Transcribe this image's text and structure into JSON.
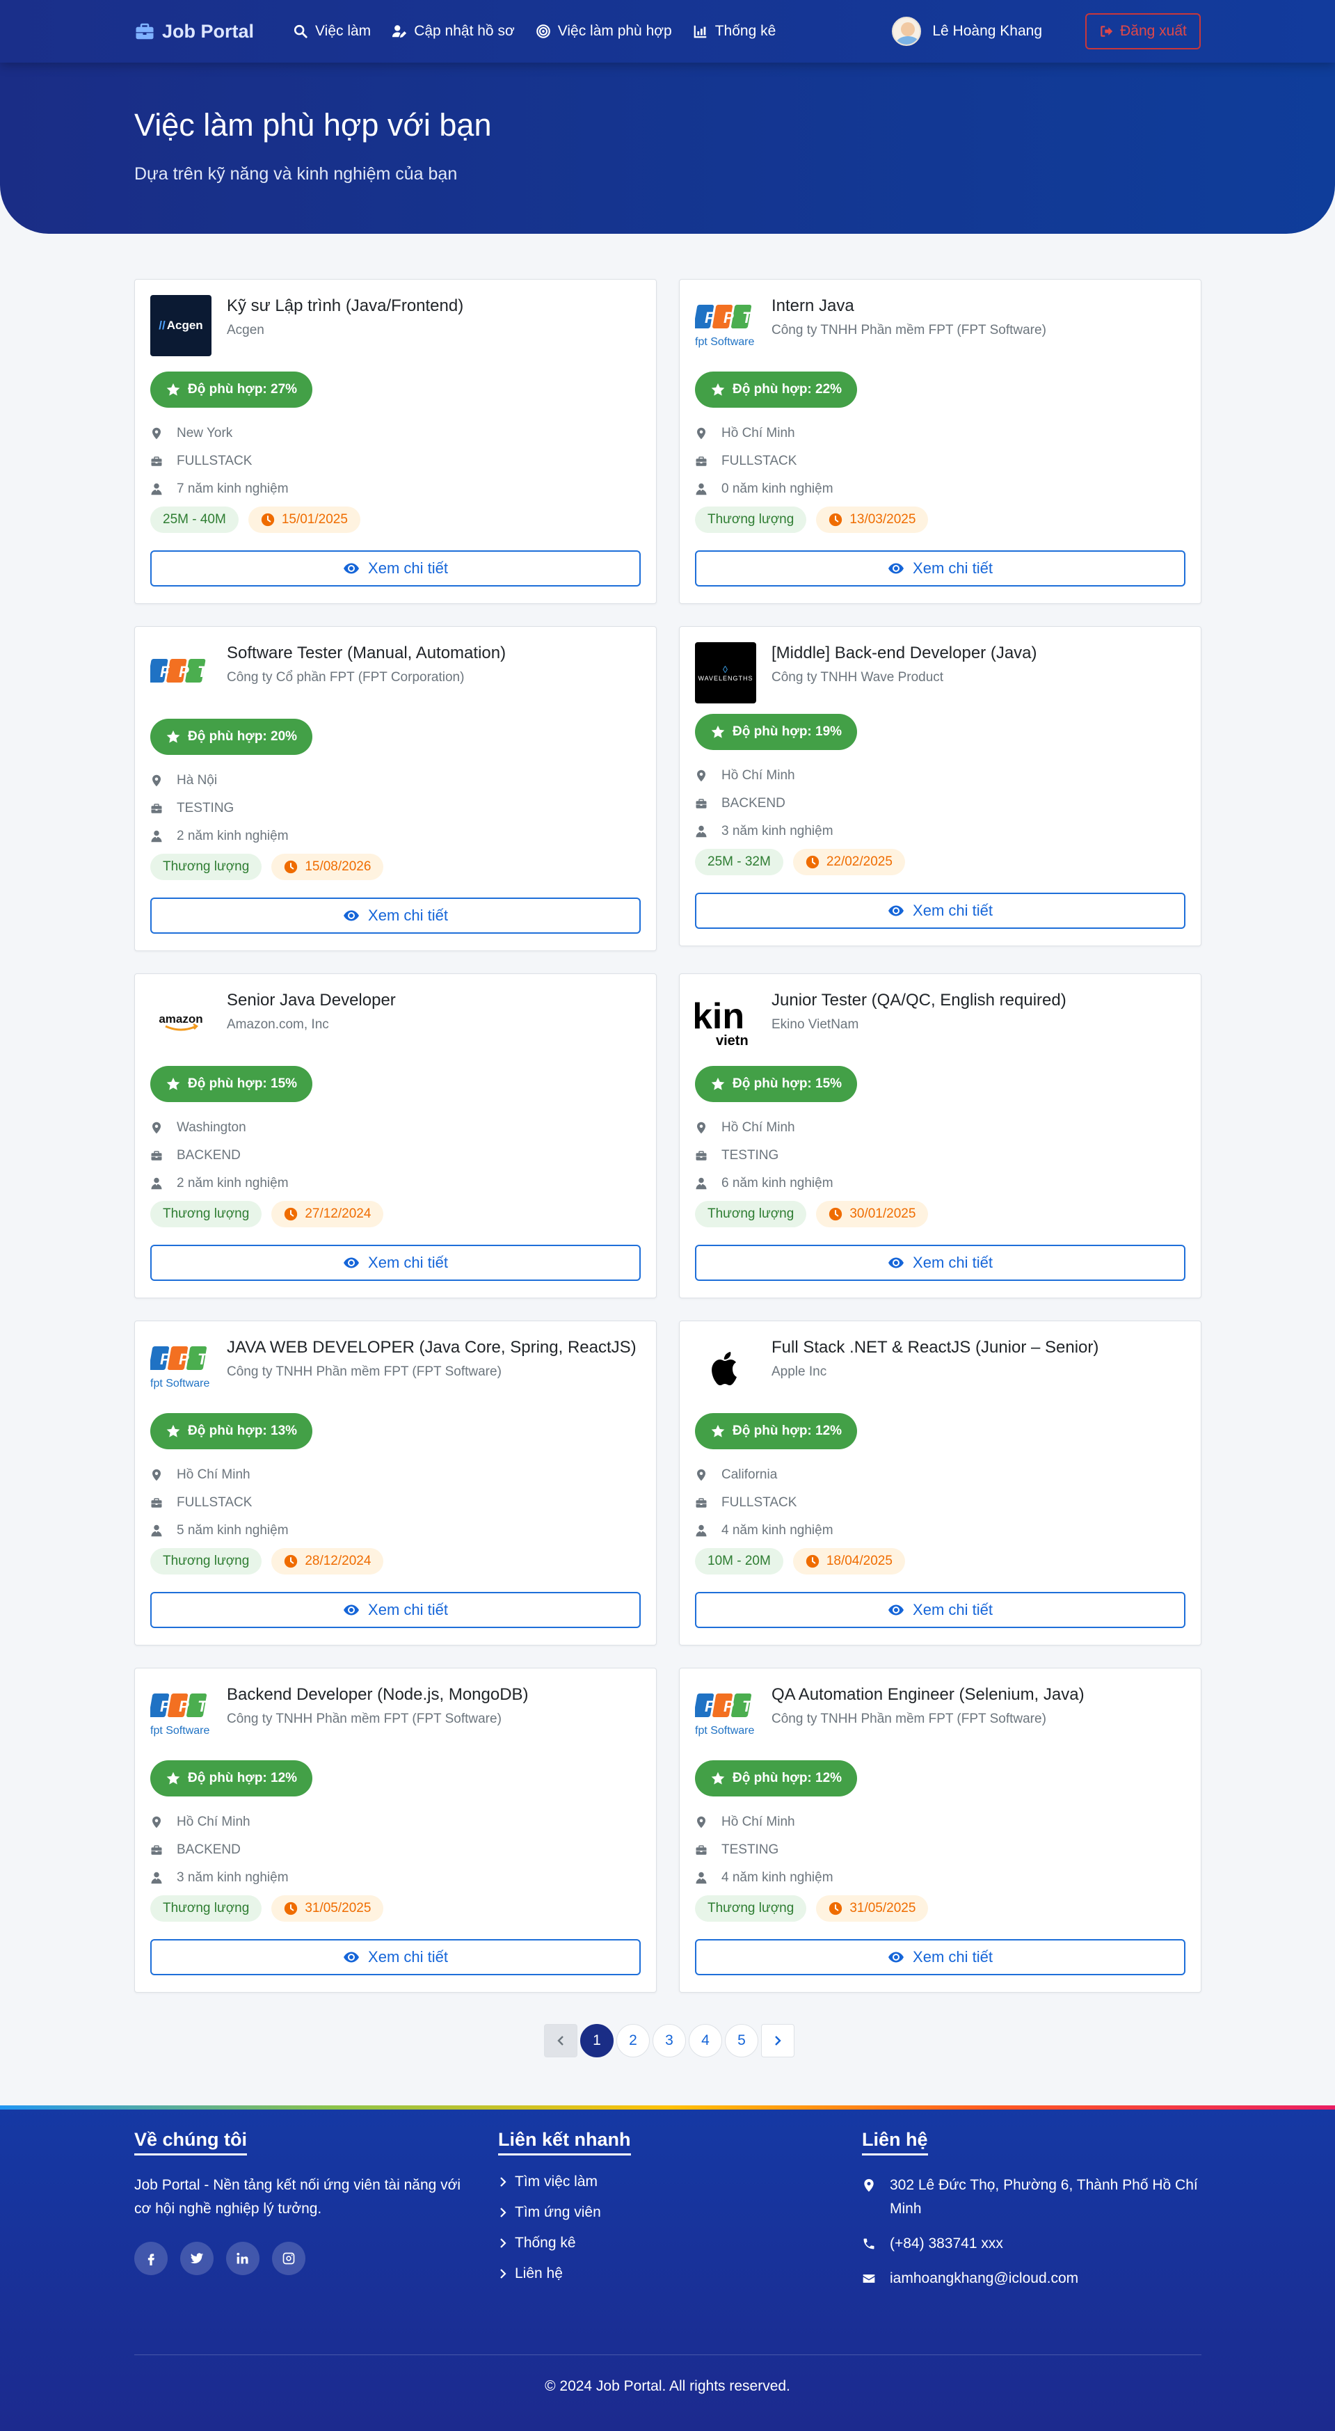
{
  "navbar": {
    "brand": "Job Portal",
    "menu": [
      {
        "label": "Việc làm",
        "icon": "search-icon"
      },
      {
        "label": "Cập nhật hồ sơ",
        "icon": "user-edit-icon"
      },
      {
        "label": "Việc làm phù hợp",
        "icon": "target-icon"
      },
      {
        "label": "Thống kê",
        "icon": "chart-icon"
      }
    ],
    "user_name": "Lê Hoàng Khang",
    "logout_label": "Đăng xuất"
  },
  "hero": {
    "title": "Việc làm phù hợp với bạn",
    "subtitle": "Dựa trên kỹ năng và kinh nghiệm của bạn"
  },
  "jobs": [
    {
      "title": "Kỹ sư Lập trình (Java/Frontend)",
      "company": "Acgen",
      "logo": "acgen",
      "match": "Độ phù hợp: 27%",
      "location": "New York",
      "category": "FULLSTACK",
      "experience": "7 năm kinh nghiệm",
      "salary": "25M - 40M",
      "deadline": "15/01/2025",
      "detail_label": "Xem chi tiết"
    },
    {
      "title": "Intern Java",
      "company": "Công ty TNHH Phần mềm FPT (FPT Software)",
      "logo": "fpt-software",
      "match": "Độ phù hợp: 22%",
      "location": "Hồ Chí Minh",
      "category": "FULLSTACK",
      "experience": "0 năm kinh nghiệm",
      "salary": "Thương lượng",
      "deadline": "13/03/2025",
      "detail_label": "Xem chi tiết"
    },
    {
      "title": "Software Tester (Manual, Automation)",
      "company": "Công ty Cổ phần FPT (FPT Corporation)",
      "logo": "fpt",
      "match": "Độ phù hợp: 20%",
      "location": "Hà Nội",
      "category": "TESTING",
      "experience": "2 năm kinh nghiệm",
      "salary": "Thương lượng",
      "deadline": "15/08/2026",
      "detail_label": "Xem chi tiết"
    },
    {
      "title": "[Middle] Back-end Developer (Java)",
      "company": "Công ty TNHH Wave Product",
      "logo": "wavelengths",
      "match": "Độ phù hợp: 19%",
      "location": "Hồ Chí Minh",
      "category": "BACKEND",
      "experience": "3 năm kinh nghiệm",
      "salary": "25M - 32M",
      "deadline": "22/02/2025",
      "detail_label": "Xem chi tiết"
    },
    {
      "title": "Senior Java Developer",
      "company": "Amazon.com, Inc",
      "logo": "amazon",
      "match": "Độ phù hợp: 15%",
      "location": "Washington",
      "category": "BACKEND",
      "experience": "2 năm kinh nghiệm",
      "salary": "Thương lượng",
      "deadline": "27/12/2024",
      "detail_label": "Xem chi tiết"
    },
    {
      "title": "Junior Tester (QA/QC, English required)",
      "company": "Ekino VietNam",
      "logo": "ekino",
      "match": "Độ phù hợp: 15%",
      "location": "Hồ Chí Minh",
      "category": "TESTING",
      "experience": "6 năm kinh nghiệm",
      "salary": "Thương lượng",
      "deadline": "30/01/2025",
      "detail_label": "Xem chi tiết"
    },
    {
      "title": "JAVA WEB DEVELOPER (Java Core, Spring, ReactJS)",
      "company": "Công ty TNHH Phần mềm FPT (FPT Software)",
      "logo": "fpt-software",
      "match": "Độ phù hợp: 13%",
      "location": "Hồ Chí Minh",
      "category": "FULLSTACK",
      "experience": "5 năm kinh nghiệm",
      "salary": "Thương lượng",
      "deadline": "28/12/2024",
      "detail_label": "Xem chi tiết"
    },
    {
      "title": "Full Stack .NET & ReactJS (Junior – Senior)",
      "company": "Apple Inc",
      "logo": "apple",
      "match": "Độ phù hợp: 12%",
      "location": "California",
      "category": "FULLSTACK",
      "experience": "4 năm kinh nghiệm",
      "salary": "10M - 20M",
      "deadline": "18/04/2025",
      "detail_label": "Xem chi tiết"
    },
    {
      "title": "Backend Developer (Node.js, MongoDB)",
      "company": "Công ty TNHH Phần mềm FPT (FPT Software)",
      "logo": "fpt-software",
      "match": "Độ phù hợp: 12%",
      "location": "Hồ Chí Minh",
      "category": "BACKEND",
      "experience": "3 năm kinh nghiệm",
      "salary": "Thương lượng",
      "deadline": "31/05/2025",
      "detail_label": "Xem chi tiết"
    },
    {
      "title": "QA Automation Engineer (Selenium, Java)",
      "company": "Công ty TNHH Phần mềm FPT (FPT Software)",
      "logo": "fpt-software",
      "match": "Độ phù hợp: 12%",
      "location": "Hồ Chí Minh",
      "category": "TESTING",
      "experience": "4 năm kinh nghiệm",
      "salary": "Thương lượng",
      "deadline": "31/05/2025",
      "detail_label": "Xem chi tiết"
    }
  ],
  "pagination": {
    "pages": [
      "1",
      "2",
      "3",
      "4",
      "5"
    ],
    "current": "1"
  },
  "footer": {
    "about_title": "Về chúng tôi",
    "about_text": "Job Portal - Nền tảng kết nối ứng viên tài năng với cơ hội nghề nghiệp lý tưởng.",
    "socials": [
      "facebook-icon",
      "twitter-icon",
      "linkedin-icon",
      "instagram-icon"
    ],
    "links_title": "Liên kết nhanh",
    "links": [
      "Tìm việc làm",
      "Tìm ứng viên",
      "Thống kê",
      "Liên hệ"
    ],
    "contact_title": "Liên hệ",
    "address": "302 Lê Đức Thọ, Phường 6, Thành Phố Hồ Chí Minh",
    "phone": "(+84) 383741 xxx",
    "email": "iamhoangkhang@icloud.com",
    "copyright": "© 2024 Job Portal. All rights reserved."
  },
  "colors": {
    "primary": "#1a2d86",
    "match_badge": "#43a047",
    "accent_link": "#1565d8",
    "logout": "#e04848"
  }
}
